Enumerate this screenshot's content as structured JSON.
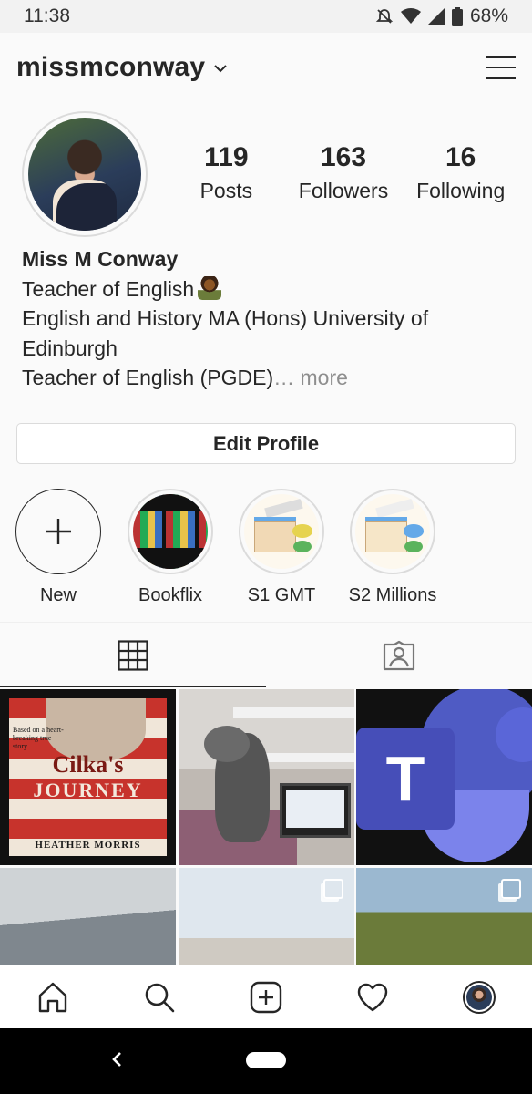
{
  "status_bar": {
    "time": "11:38",
    "battery": "68%"
  },
  "header": {
    "username": "missmconway"
  },
  "stats": [
    {
      "value": "119",
      "label": "Posts"
    },
    {
      "value": "163",
      "label": "Followers"
    },
    {
      "value": "16",
      "label": "Following"
    }
  ],
  "bio": {
    "name": "Miss M Conway",
    "line1": "Teacher of English",
    "line2": "English and History MA (Hons) University of Edinburgh",
    "line3": "Teacher of English (PGDE)",
    "more": "… more"
  },
  "edit_profile_label": "Edit Profile",
  "highlights": [
    {
      "label": "New"
    },
    {
      "label": "Bookflix"
    },
    {
      "label": "S1 GMT"
    },
    {
      "label": "S2 Millions"
    }
  ],
  "posts": {
    "cilka": {
      "tagline": "Based on a heart-breaking true story",
      "title1": "Cilka's",
      "title2": "JOURNEY",
      "author": "HEATHER MORRIS"
    },
    "teams_letter": "T"
  }
}
